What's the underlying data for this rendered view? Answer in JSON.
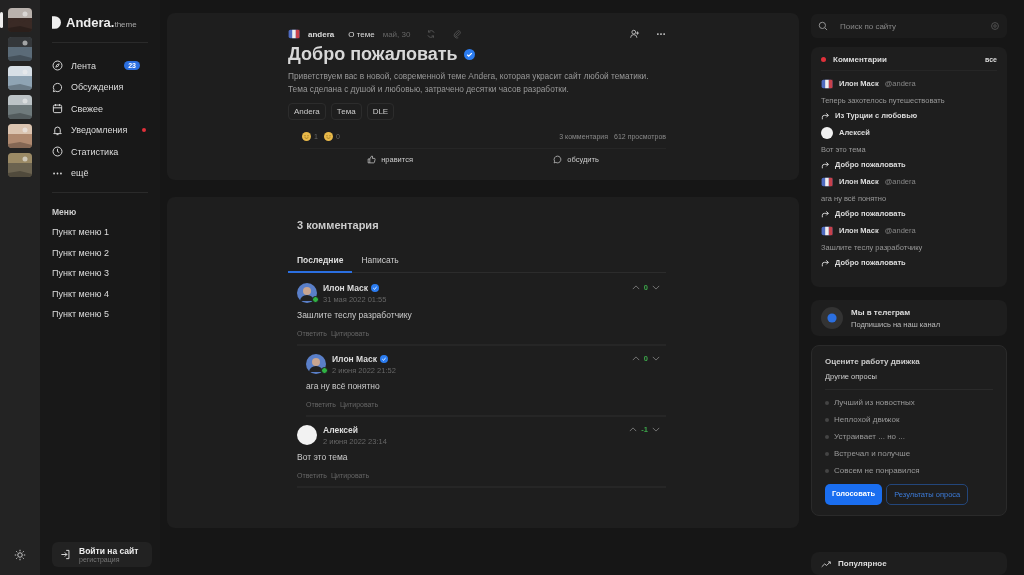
{
  "thumbnails": [
    {
      "kind": "picture",
      "selected": true
    },
    {
      "kind": "picture",
      "selected": false
    },
    {
      "kind": "picture",
      "selected": false
    },
    {
      "kind": "picture",
      "selected": false
    },
    {
      "kind": "picture",
      "selected": false
    },
    {
      "kind": "picture",
      "selected": false
    }
  ],
  "logo": {
    "name": "Andera.",
    "suffix": "theme"
  },
  "nav": [
    {
      "kind": "compass",
      "label": "Лента",
      "badge": "23",
      "dot": false
    },
    {
      "kind": "chat",
      "label": "Обсуждения",
      "dot": false
    },
    {
      "kind": "calendar",
      "label": "Свежее",
      "dot": false
    },
    {
      "kind": "bell",
      "label": "Уведомления",
      "dot": true
    },
    {
      "kind": "clock",
      "label": "Статистика",
      "dot": false
    },
    {
      "kind": "more",
      "label": "ещё",
      "dot": false
    }
  ],
  "menu": {
    "title": "Меню",
    "items": [
      "Пункт меню 1",
      "Пункт меню 2",
      "Пункт меню 3",
      "Пункт меню 4",
      "Пункт меню 5"
    ]
  },
  "login": {
    "label": "Войти на сайт",
    "sub": "регистрация"
  },
  "post": {
    "author": "andera",
    "category": "О теме",
    "date": "май, 30",
    "title": "Добро пожаловать",
    "verified": true,
    "text": "Приветствуем вас в новой, современной теме Andera, которая украсит сайт любой тематики. Тема сделана с душой и любовью, затрачено десятки часов разработки.",
    "tags": [
      "Andera",
      "Тема",
      "DLE"
    ],
    "reactions": [
      {
        "count": "1"
      },
      {
        "count": "0"
      }
    ],
    "comments_count": "3 комментария",
    "views": "612 просмотров",
    "actions": [
      {
        "kind": "like",
        "label": "нравится"
      },
      {
        "kind": "discuss",
        "label": "обсудить"
      }
    ]
  },
  "comments_section": {
    "title": "3 комментария",
    "tabs": [
      {
        "label": "Последние",
        "selected": true
      },
      {
        "label": "Написать",
        "selected": false
      }
    ],
    "comments": [
      {
        "kind": "person",
        "name": "Илон Маск",
        "verified": true,
        "online": true,
        "date": "31 мая 2022 01:55",
        "text": "Зашлите теслу разработчику",
        "votes": "0",
        "actions": [
          "Ответить",
          "Цитировать"
        ],
        "children": [
          {
            "kind": "person",
            "name": "Илон Маск",
            "verified": true,
            "online": true,
            "date": "2 июня 2022 21:52",
            "text": "ага ну всё понятно",
            "votes": "0",
            "actions": [
              "Ответить",
              "Цитировать"
            ]
          }
        ]
      },
      {
        "kind": "blank",
        "name": "Алексей",
        "verified": false,
        "online": false,
        "date": "2 июня 2022 23:14",
        "text": "Вот это тема",
        "votes": "-1",
        "actions": [
          "Ответить",
          "Цитировать"
        ]
      }
    ]
  },
  "search": {
    "placeholder": "Поиск по сайту"
  },
  "latest_comments": {
    "title": "Комментарии",
    "link": "все",
    "items": [
      {
        "kind": "flag",
        "name": "Илон Маск",
        "handle": "@andera",
        "text": "Теперь захотелось путешествовать",
        "post": "Из Турции с любовью"
      },
      {
        "kind": "blank",
        "name": "Алексей",
        "text": "Вот это тема",
        "post": "Добро пожаловать"
      },
      {
        "kind": "flag",
        "name": "Илон Маск",
        "handle": "@andera",
        "text": "ага ну всё понятно",
        "post": "Добро пожаловать"
      },
      {
        "kind": "flag",
        "name": "Илон Маск",
        "handle": "@andera",
        "text": "Зашлите теслу разработчику",
        "post": "Добро пожаловать"
      }
    ]
  },
  "telegram": {
    "title": "Мы в телеграм",
    "sub": "Подпишись на наш канал"
  },
  "poll": {
    "title": "Оцените работу движка",
    "link": "Другие опросы",
    "options": [
      {
        "label": "Лучший из новостных",
        "selected": false
      },
      {
        "label": "Неплохой движок",
        "selected": false
      },
      {
        "label": "Устраивает ... но ...",
        "selected": false
      },
      {
        "label": "Встречал и получше",
        "selected": false
      },
      {
        "label": "Совсем не понравился",
        "selected": false
      }
    ],
    "vote": "Голосовать",
    "results": "Результаты опроса"
  },
  "popular": {
    "title": "Популярное"
  }
}
